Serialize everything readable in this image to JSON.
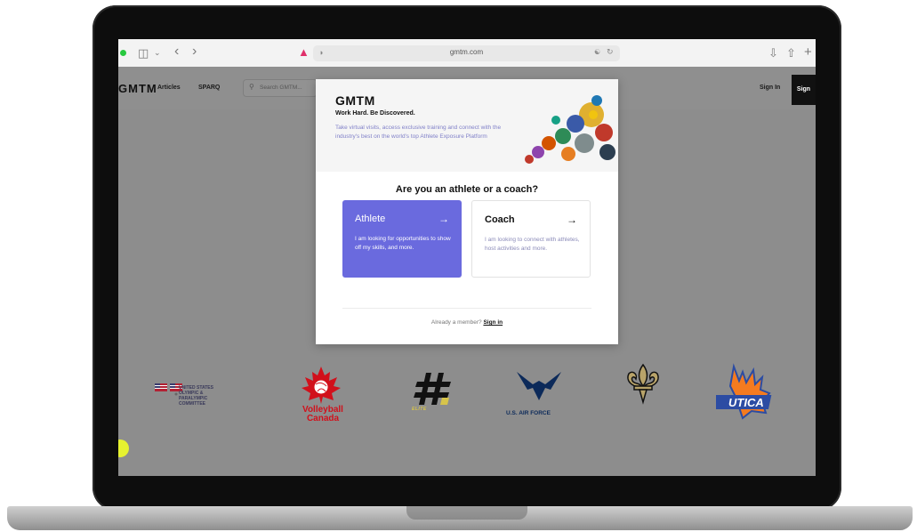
{
  "browser": {
    "url": "gmtm.com"
  },
  "site_header": {
    "logo": "GMTM",
    "nav": [
      "Articles",
      "SPARQ"
    ],
    "search_placeholder": "Search GMTM...",
    "sign_in": "Sign In",
    "sign_up": "Sign"
  },
  "modal": {
    "logo": "GMTM",
    "tagline": "Work Hard. Be Discovered.",
    "description": "Take virtual visits, access exclusive training and connect with the industry's best on the world's top Athlete Exposure Platform",
    "question": "Are you an athlete or a coach?",
    "athlete": {
      "title": "Athlete",
      "description": "I am looking for opportunities to show off my skills, and more."
    },
    "coach": {
      "title": "Coach",
      "description": "I am looking to connect with athletes, host activities and more."
    },
    "member_prompt": "Already a member?",
    "sign_in": "Sign in"
  },
  "partners": {
    "usopc": "UNITED STATES OLYMPIC & PARALYMPIC COMMITTEE",
    "volleyball_canada_1": "Volleyball",
    "volleyball_canada_2": "Canada",
    "elite": "ELITE",
    "air_force": "U.S. AIR FORCE"
  },
  "colors": {
    "athlete_card": "#6a6ade",
    "overlay": "#8d8d8d",
    "volleyball_red": "#d1101b",
    "saints_gold": "#b8a369",
    "utica_orange": "#f47b20",
    "utica_blue": "#2c4ca3"
  },
  "icons": [
    "sidebar-icon",
    "back-icon",
    "forward-icon",
    "extension-icon",
    "shield-icon",
    "translate-icon",
    "reload-icon",
    "download-icon",
    "share-icon",
    "new-tab-icon",
    "search-icon",
    "arrow-right-icon"
  ]
}
